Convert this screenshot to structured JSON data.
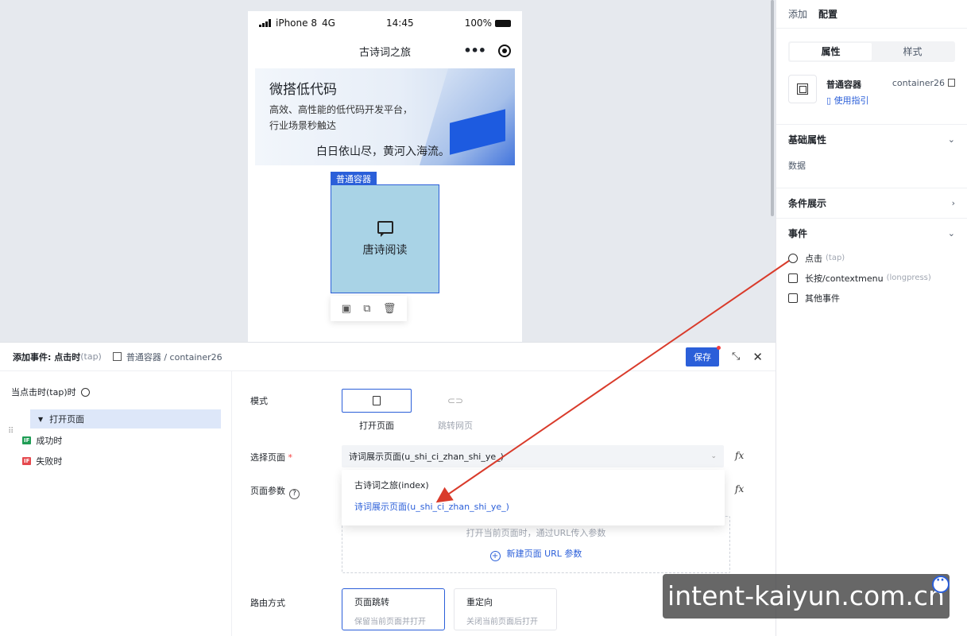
{
  "phone": {
    "carrier": "iPhone 8",
    "network": "4G",
    "time": "14:45",
    "battery": "100%",
    "nav_title": "古诗词之旅",
    "banner": {
      "title": "微搭低代码",
      "desc": "高效、高性能的低代码开发平台，行业场景秒触达",
      "poem": "白日依山尽，黄河入海流。"
    },
    "container_tag": "普通容器",
    "container_label": "唐诗阅读"
  },
  "right_panel": {
    "tabs": [
      "添加",
      "配置"
    ],
    "segment": [
      "属性",
      "样式"
    ],
    "component": {
      "name": "普通容器",
      "guide": "使用指引",
      "id": "container26"
    },
    "sections": {
      "basic": "基础属性",
      "basic_body": "数据",
      "conditional": "条件展示",
      "events": "事件"
    },
    "events": [
      {
        "label": "点击",
        "hint": "(tap)"
      },
      {
        "label": "长按/contextmenu",
        "hint": "(longpress)"
      },
      {
        "label": "其他事件",
        "hint": ""
      }
    ]
  },
  "editor": {
    "title": "添加事件: 点击时",
    "title_hint": "(tap)",
    "breadcrumb": "普通容器 / container26",
    "save_label": "保存",
    "trigger": "当点击时(tap)时",
    "tree": {
      "action": "打开页面",
      "success": "成功时",
      "fail": "失败时",
      "if_badge": "IF"
    },
    "form": {
      "mode_label": "模式",
      "mode_open": "打开页面",
      "mode_jump": "跳转网页",
      "page_label": "选择页面",
      "page_required": "*",
      "page_value": "诗词展示页面(u_shi_ci_zhan_shi_ye_)",
      "options": [
        "古诗词之旅(index)",
        "诗词展示页面(u_shi_ci_zhan_shi_ye_)"
      ],
      "params_label": "页面参数",
      "params_hint": "打开当前页面时，通过URL传入参数",
      "params_add": "新建页面 URL 参数",
      "route_label": "路由方式",
      "route_options": [
        {
          "title": "页面跳转",
          "desc": "保留当前页面并打开"
        },
        {
          "title": "重定向",
          "desc": "关闭当前页面后打开"
        }
      ],
      "fx": "fx"
    }
  },
  "watermark": "intent-kaiyun.com.cn",
  "colors": {
    "accent": "#2b5fd9",
    "arrow": "#d93b2b",
    "container_fill": "#a9d3e6"
  }
}
